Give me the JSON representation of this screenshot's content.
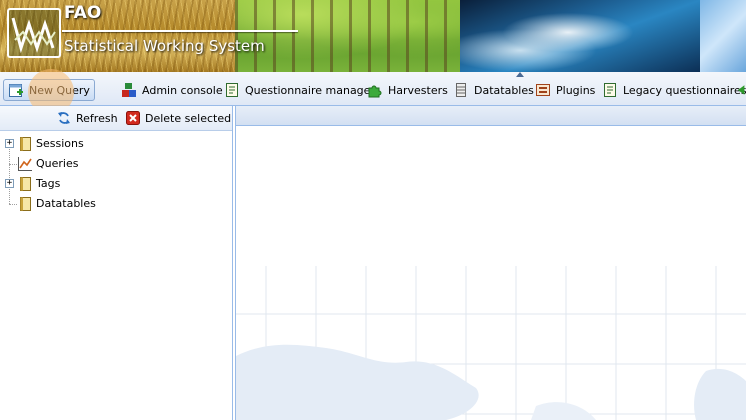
{
  "banner": {
    "brand": "FAO",
    "subtitle": "Statistical Working System"
  },
  "toolbar": {
    "items": [
      {
        "label": "New Query",
        "icon": "new-query-icon"
      },
      {
        "label": "Admin console",
        "icon": "admin-console-icon"
      },
      {
        "label": "Questionnaire manager",
        "icon": "questionnaire-icon"
      },
      {
        "label": "Harvesters",
        "icon": "puzzle-icon"
      },
      {
        "label": "Datatables",
        "icon": "datatable-icon"
      },
      {
        "label": "Plugins",
        "icon": "plugin-icon"
      },
      {
        "label": "Legacy questionnaires",
        "icon": "questionnaire-icon"
      }
    ]
  },
  "left_panel": {
    "refresh_label": "Refresh",
    "delete_label": "Delete selected",
    "tree": [
      {
        "label": "Sessions",
        "expandable": true,
        "icon": "book-icon"
      },
      {
        "label": "Queries",
        "expandable": false,
        "icon": "chart-icon"
      },
      {
        "label": "Tags",
        "expandable": true,
        "icon": "book-icon"
      },
      {
        "label": "Datatables",
        "expandable": false,
        "icon": "book-icon"
      }
    ]
  },
  "colors": {
    "toolbar_border": "#99bbe8",
    "click_marker": "#fab96e"
  }
}
